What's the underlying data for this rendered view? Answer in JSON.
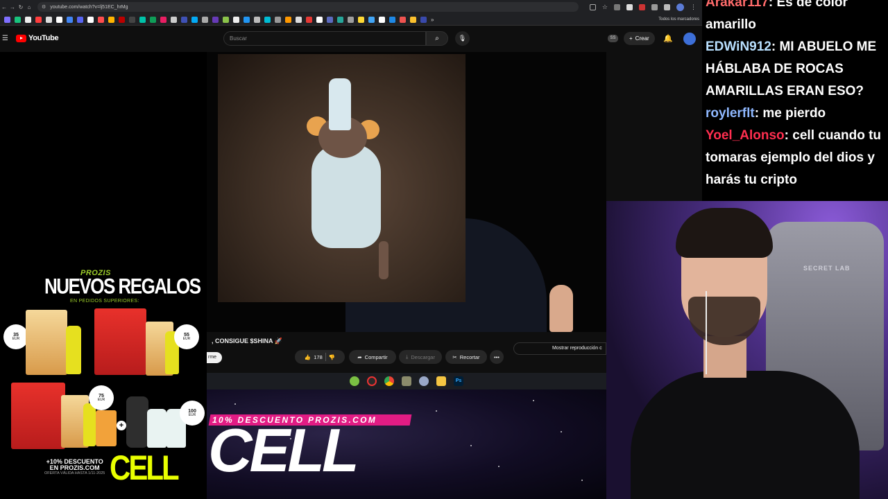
{
  "browser": {
    "url": "youtube.com/watch?v=lj51EC_hrMg",
    "bookmarks_label": "Todos los marcadores"
  },
  "youtube": {
    "logo_text": "YouTube",
    "search_placeholder": "Buscar",
    "ss_badge": "SS",
    "create_label": "Crear"
  },
  "video": {
    "title": ", CONSIGUE $SHINA 🚀",
    "subscribe_partial": "rme",
    "likes": "178",
    "share_label": "Compartir",
    "download_label": "Descargar",
    "clip_label": "Recortar",
    "more_label": "•••",
    "playback_label": "Mostrar reproducción c"
  },
  "promo_left": {
    "brand": "PROZIS",
    "title": "NUEVOS REGALOS",
    "subtitle": "EN PEDIDOS SUPERIORES:",
    "price_1": "35",
    "price_2": "55",
    "price_3": "75",
    "price_4": "100",
    "currency": "EUR",
    "discount_line1": "+10% DESCUENTO",
    "discount_line2": "EN PROZIS.COM",
    "validity": "OFERTA VÁLIDA HASTA 1/11-2025",
    "cell_small": "CELL"
  },
  "promo_bottom": {
    "discount_banner": "10% DESCUENTO PROZIS.COM",
    "cell_big": "CELL"
  },
  "chat": {
    "messages": [
      {
        "user": "Arakar117",
        "text": ": Es de color amarillo",
        "color": "#ff6b6b"
      },
      {
        "user": "EDWiN912",
        "text": ": MI ABUELO ME HÁBLABA DE ROCAS AMARILLAS ERAN ESO?",
        "color": "#b9e0ff"
      },
      {
        "user": "roylerflt",
        "text": ": me pierdo",
        "color": "#8fb8ff"
      },
      {
        "user": "Yoel_Alonso",
        "text": ": cell cuando tu tomaras ejemplo del dios y harás tu cripto",
        "color": "#ff2e4f"
      }
    ]
  },
  "webcam": {
    "chair_brand": "SECRET LAB"
  }
}
